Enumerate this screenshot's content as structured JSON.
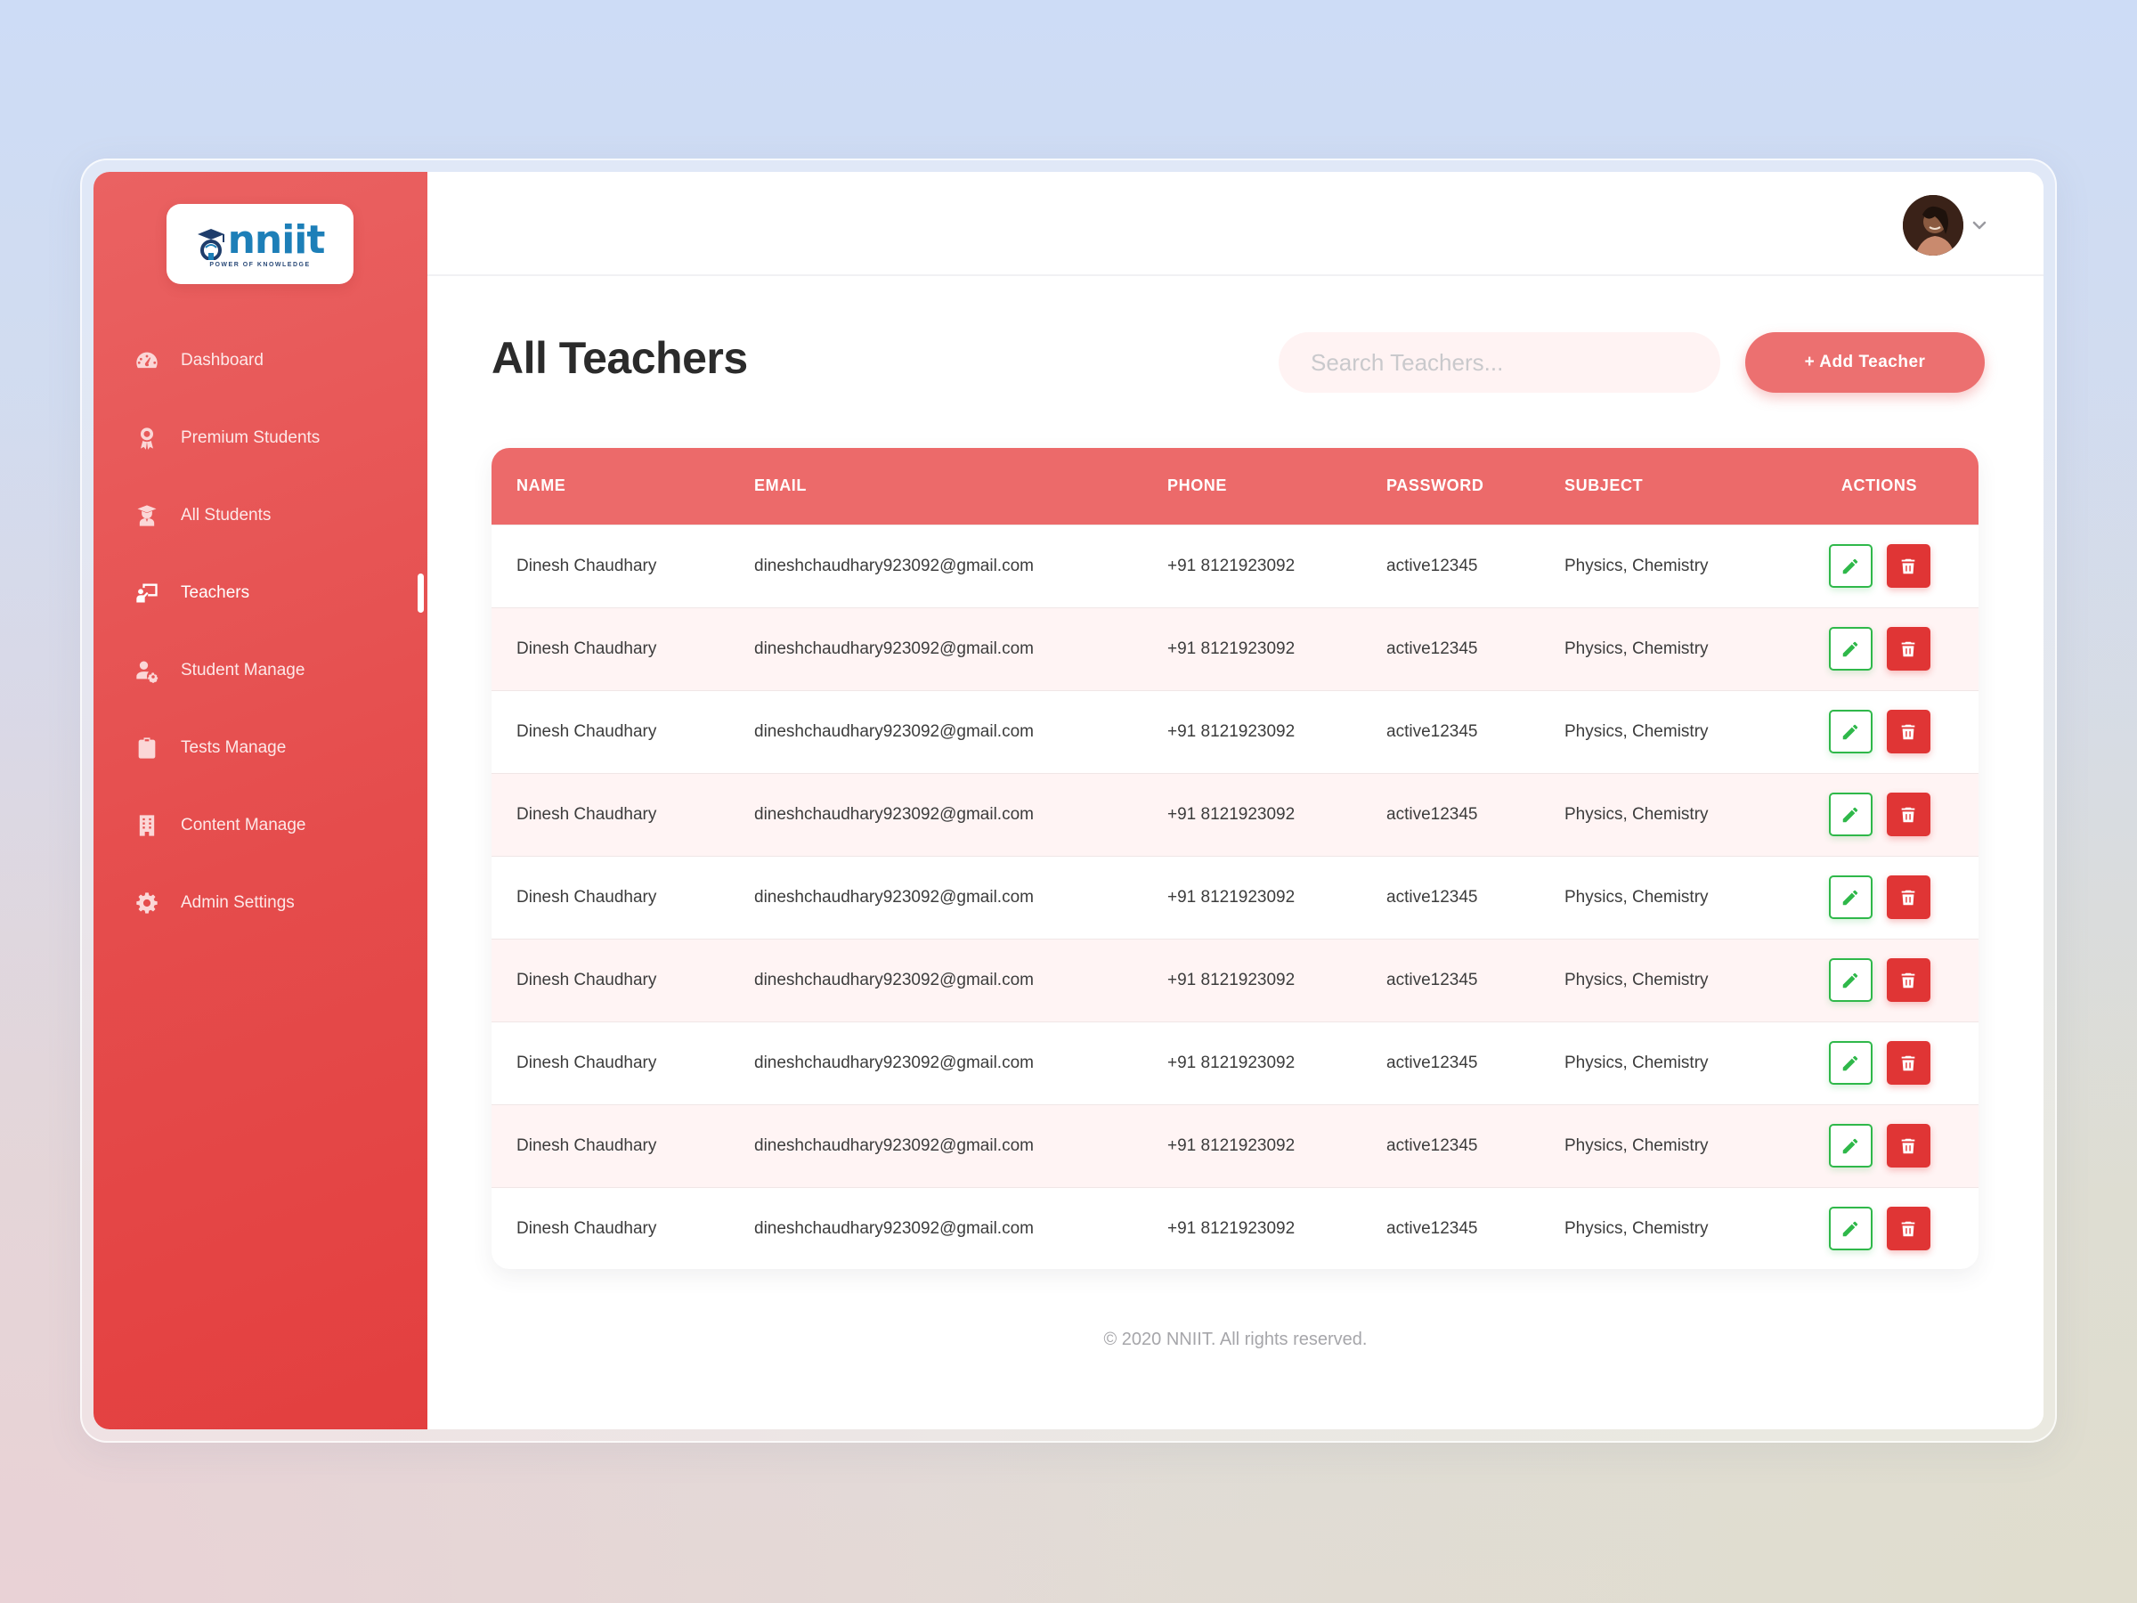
{
  "brand": {
    "name": "nniit",
    "tagline": "POWER OF KNOWLEDGE"
  },
  "sidebar": {
    "items": [
      {
        "label": "Dashboard",
        "icon": "gauge-icon"
      },
      {
        "label": "Premium Students",
        "icon": "award-icon"
      },
      {
        "label": "All Students",
        "icon": "student-icon"
      },
      {
        "label": "Teachers",
        "icon": "teacher-icon",
        "active": true
      },
      {
        "label": "Student Manage",
        "icon": "user-cog-icon"
      },
      {
        "label": "Tests Manage",
        "icon": "clipboard-icon"
      },
      {
        "label": "Content Manage",
        "icon": "building-icon"
      },
      {
        "label": "Admin Settings",
        "icon": "gear-icon"
      }
    ]
  },
  "header": {
    "title": "All Teachers",
    "search_placeholder": "Search Teachers...",
    "add_button": "+ Add Teacher"
  },
  "table": {
    "columns": [
      "NAME",
      "EMAIL",
      "PHONE",
      "PASSWORD",
      "SUBJECT",
      "ACTIONS"
    ],
    "rows": [
      {
        "name": "Dinesh Chaudhary",
        "email": "dineshchaudhary923092@gmail.com",
        "phone": "+91 8121923092",
        "password": "active12345",
        "subject": "Physics, Chemistry"
      },
      {
        "name": "Dinesh Chaudhary",
        "email": "dineshchaudhary923092@gmail.com",
        "phone": "+91 8121923092",
        "password": "active12345",
        "subject": "Physics, Chemistry"
      },
      {
        "name": "Dinesh Chaudhary",
        "email": "dineshchaudhary923092@gmail.com",
        "phone": "+91 8121923092",
        "password": "active12345",
        "subject": "Physics, Chemistry"
      },
      {
        "name": "Dinesh Chaudhary",
        "email": "dineshchaudhary923092@gmail.com",
        "phone": "+91 8121923092",
        "password": "active12345",
        "subject": "Physics, Chemistry"
      },
      {
        "name": "Dinesh Chaudhary",
        "email": "dineshchaudhary923092@gmail.com",
        "phone": "+91 8121923092",
        "password": "active12345",
        "subject": "Physics, Chemistry"
      },
      {
        "name": "Dinesh Chaudhary",
        "email": "dineshchaudhary923092@gmail.com",
        "phone": "+91 8121923092",
        "password": "active12345",
        "subject": "Physics, Chemistry"
      },
      {
        "name": "Dinesh Chaudhary",
        "email": "dineshchaudhary923092@gmail.com",
        "phone": "+91 8121923092",
        "password": "active12345",
        "subject": "Physics, Chemistry"
      },
      {
        "name": "Dinesh Chaudhary",
        "email": "dineshchaudhary923092@gmail.com",
        "phone": "+91 8121923092",
        "password": "active12345",
        "subject": "Physics, Chemistry"
      },
      {
        "name": "Dinesh Chaudhary",
        "email": "dineshchaudhary923092@gmail.com",
        "phone": "+91 8121923092",
        "password": "active12345",
        "subject": "Physics, Chemistry"
      }
    ]
  },
  "footer": {
    "text": "© 2020 NNIIT. All rights reserved."
  },
  "colors": {
    "primary": "#ec6a6a",
    "sidebar": "#e54c4c",
    "edit": "#2fb84a",
    "delete": "#e03535"
  }
}
